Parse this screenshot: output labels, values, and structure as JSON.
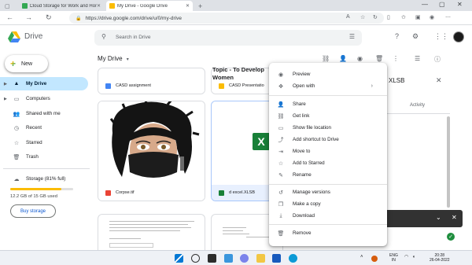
{
  "browser": {
    "tabs": [
      {
        "title": "Cloud Storage for Work and Home",
        "active": false
      },
      {
        "title": "My Drive - Google Drive",
        "active": true
      }
    ],
    "url": "https://drive.google.com/drive/u/0/my-drive"
  },
  "header": {
    "brand": "Drive",
    "search_placeholder": "Search in Drive"
  },
  "sidebar": {
    "new_label": "New",
    "items": [
      {
        "label": "My Drive",
        "icon": "drive-icon",
        "active": true
      },
      {
        "label": "Computers",
        "icon": "computer-icon",
        "active": false
      },
      {
        "label": "Shared with me",
        "icon": "people-icon",
        "active": false
      },
      {
        "label": "Recent",
        "icon": "clock-icon",
        "active": false
      },
      {
        "label": "Starred",
        "icon": "star-icon",
        "active": false
      },
      {
        "label": "Trash",
        "icon": "trash-icon",
        "active": false
      }
    ],
    "storage_label": "Storage (81% full)",
    "storage_used": "12.2 GB of 15 GB used",
    "storage_fraction": 0.81,
    "buy_label": "Buy storage"
  },
  "main": {
    "breadcrumb": "My Drive",
    "files": [
      {
        "name": "CASD assignment",
        "type": "doc"
      },
      {
        "name": "CASD Presentatio",
        "type": "slides"
      },
      {
        "name": "Topic - To Develop",
        "type": "doc-preview"
      },
      {
        "name": "Women",
        "type": "doc-preview-cont"
      },
      {
        "name": "Corpse.tif",
        "type": "image"
      },
      {
        "name": "d excel.XLSB",
        "type": "sheet"
      }
    ]
  },
  "details": {
    "title": "XLSB",
    "tab": "Activity"
  },
  "context_menu": {
    "items": [
      {
        "label": "Preview",
        "icon": "eye-icon"
      },
      {
        "label": "Open with",
        "icon": "move-icon",
        "submenu": true
      },
      {
        "label": "Share",
        "icon": "share-person-icon"
      },
      {
        "label": "Get link",
        "icon": "link-icon"
      },
      {
        "label": "Show file location",
        "icon": "folder-icon"
      },
      {
        "label": "Add shortcut to Drive",
        "icon": "shortcut-icon"
      },
      {
        "label": "Move to",
        "icon": "move-folder-icon"
      },
      {
        "label": "Add to Starred",
        "icon": "star-outline-icon"
      },
      {
        "label": "Rename",
        "icon": "pencil-icon"
      },
      {
        "label": "Manage versions",
        "icon": "history-icon"
      },
      {
        "label": "Make a copy",
        "icon": "copy-icon"
      },
      {
        "label": "Download",
        "icon": "download-icon"
      },
      {
        "label": "Remove",
        "icon": "trash-icon"
      }
    ]
  },
  "taskbar": {
    "lang": "ENG",
    "region": "IN",
    "time": "20:28",
    "date": "26-04-2022"
  },
  "colors": {
    "accent": "#0b57d0",
    "active_nav": "#c2e7ff",
    "storage_fill": "#fbbc04"
  }
}
